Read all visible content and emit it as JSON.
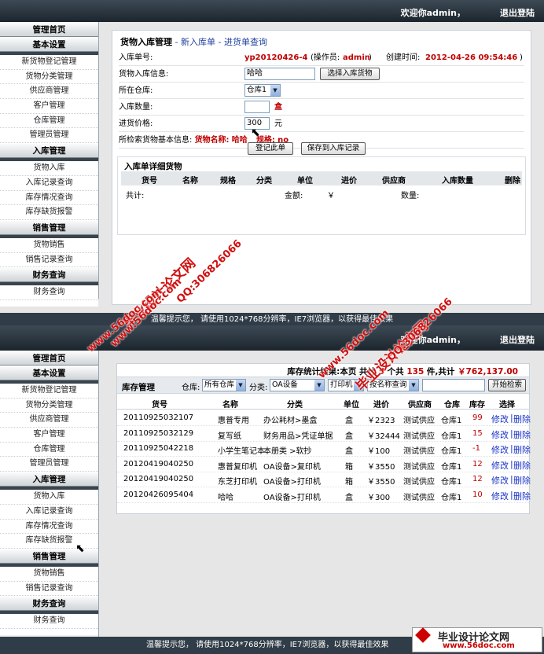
{
  "shot1": {
    "welcome": "欢迎你admin，",
    "logout": "退出登陆",
    "sidebar": {
      "h1": "管理首页",
      "h2": "基本设置",
      "items_a": [
        "新货物登记管理",
        "货物分类管理",
        "供应商管理",
        "客户管理",
        "仓库管理",
        "管理员管理"
      ],
      "h3": "入库管理",
      "items_b": [
        "货物入库",
        "入库记录查询",
        "库存情况查询",
        "库存缺货报警"
      ],
      "h4": "销售管理",
      "items_c": [
        "货物销售",
        "销售记录查询"
      ],
      "h5": "财务查询",
      "items_d": [
        "财务查询"
      ]
    },
    "form": {
      "title": "货物入库管理",
      "dash1": "-",
      "nav1": "新入库单",
      "dash2": "-",
      "nav2": "进货单查询",
      "no_label": "入库单号:",
      "no_value": "yp20120426-4",
      "op_label": "(操作员:",
      "op_value": "admin",
      "op_close": ")",
      "created_label": "创建时间:",
      "created_value": "2012-04-26 09:54:46",
      "created_close": ")",
      "goods_label": "货物入库信息:",
      "goods_value": "哈哈",
      "goods_btn": "选择入库货物",
      "wh_label": "所在仓库:",
      "wh_value": "仓库1",
      "qty_label": "入库数量:",
      "qty_value": "",
      "qty_unit": "盒",
      "price_label": "进货价格:",
      "price_value": "300",
      "price_unit": "元",
      "info_label": "所检索货物基本信息:",
      "info_name_label": "货物名称:",
      "info_name": "哈哈",
      "info_spec_label": "规格:",
      "info_spec": "no",
      "btn_register": "登记此单",
      "btn_save": "保存到入库记录"
    },
    "detail": {
      "title": "入库单详细货物",
      "headers": [
        "货号",
        "名称",
        "规格",
        "分类",
        "单位",
        "进价",
        "供应商",
        "入库数量",
        "删除"
      ],
      "total_label": "共计:",
      "amount_label": "金额:",
      "amount_value": "￥",
      "qty_label": "数量:"
    },
    "footer": "温馨提示您， 请使用1024*768分辨率，IE7浏览器，以获得最佳效果"
  },
  "shot2": {
    "welcome": "欢迎你admin，",
    "logout": "退出登陆",
    "list": {
      "summary_pre": "库存统计结果:本页",
      "summary_count_label": "共计",
      "summary_count": "5",
      "summary_count_unit": "个共",
      "summary_items": "135",
      "summary_items_unit": "件,共计",
      "summary_total": "￥762,137.00",
      "title": "库存管理",
      "wh_label": "仓库:",
      "wh_value": "所有仓库",
      "cat_label": "分类:",
      "cat_value": "OA设备",
      "sub_value": "打印机",
      "search_mode": "按名称查询",
      "search_value": "",
      "search_btn": "开始检索",
      "headers": [
        "货号",
        "名称",
        "分类",
        "单位",
        "进价",
        "供应商",
        "仓库",
        "库存",
        "选择"
      ],
      "rows": [
        {
          "code": "20110925032107",
          "name": "惠普专用",
          "cat": "办公耗材>墨盒",
          "unit": "盒",
          "price": "￥2323",
          "sup": "测试供应",
          "wh": "仓库1",
          "stock": "99",
          "edit": "修改",
          "sep": "|",
          "del": "删除"
        },
        {
          "code": "20110925032129",
          "name": "复写纸",
          "cat": "财务用品>凭证单据",
          "unit": "盒",
          "price": "￥32444",
          "sup": "测试供应",
          "wh": "仓库1",
          "stock": "15",
          "edit": "修改",
          "sep": "|",
          "del": "删除"
        },
        {
          "code": "20110925042218",
          "name": "小学生笔记本",
          "cat": "本册类 >软抄",
          "unit": "盒",
          "price": "￥100",
          "sup": "测试供应",
          "wh": "仓库1",
          "stock": "-1",
          "edit": "修改",
          "sep": "|",
          "del": "删除"
        },
        {
          "code": "20120419040250",
          "name": "惠普复印机",
          "cat": "OA设备>复印机",
          "unit": "箱",
          "price": "￥3550",
          "sup": "测试供应",
          "wh": "仓库1",
          "stock": "12",
          "edit": "修改",
          "sep": "|",
          "del": "删除"
        },
        {
          "code": "20120419040250",
          "name": "东芝打印机",
          "cat": "OA设备>打印机",
          "unit": "箱",
          "price": "￥3550",
          "sup": "测试供应",
          "wh": "仓库1",
          "stock": "12",
          "edit": "修改",
          "sep": "|",
          "del": "删除"
        },
        {
          "code": "20120426095404",
          "name": "哈哈",
          "cat": "OA设备>打印机",
          "unit": "盒",
          "price": "￥300",
          "sup": "测试供应",
          "wh": "仓库1",
          "stock": "10",
          "edit": "修改",
          "sep": "|",
          "del": "删除"
        }
      ]
    },
    "footer": "温馨提示您， 请使用1024*768分辨率，IE7浏览器，以获得最佳效果"
  },
  "watermarks": {
    "a": "毕业设计论文网",
    "b": "www.56doc.com",
    "c": "QQ:306826066",
    "logo_title": "毕业设计论文网",
    "logo_url": "www.56doc.com"
  },
  "colors": {
    "topbar": "#1c252d",
    "accent_red": "#c00000",
    "link_blue": "#1a33c6",
    "watermark": "#d01010"
  }
}
